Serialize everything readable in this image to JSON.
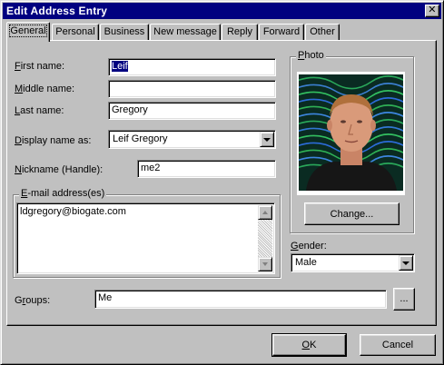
{
  "window": {
    "title": "Edit Address Entry",
    "close_glyph": "✕"
  },
  "tabs": [
    {
      "label": "General",
      "active": true
    },
    {
      "label": "Personal"
    },
    {
      "label": "Business"
    },
    {
      "label": "New message"
    },
    {
      "label": "Reply"
    },
    {
      "label": "Forward"
    },
    {
      "label": "Other"
    }
  ],
  "general": {
    "first_name": {
      "label_hotkey": "F",
      "label_rest": "irst name:",
      "value": "Leif"
    },
    "middle_name": {
      "label_hotkey": "M",
      "label_rest": "iddle name:",
      "value": ""
    },
    "last_name": {
      "label_hotkey": "L",
      "label_rest": "ast name:",
      "value": "Gregory"
    },
    "display_name": {
      "label_hotkey": "D",
      "label_rest": "isplay name as:",
      "value": "Leif Gregory"
    },
    "nickname": {
      "label_hotkey": "N",
      "label_rest": "ickname (Handle):",
      "value": "me2"
    },
    "email": {
      "legend_hotkey": "E",
      "legend_rest": "-mail address(es)",
      "value": "ldgregory@biogate.com"
    },
    "groups": {
      "label_pre": "G",
      "label_hotkey": "r",
      "label_rest": "oups:",
      "value": "Me",
      "browse_label": "..."
    }
  },
  "photo": {
    "legend_hotkey": "P",
    "legend_rest": "hoto",
    "change_label": "Change..."
  },
  "gender": {
    "label_hotkey": "G",
    "label_rest": "ender:",
    "value": "Male"
  },
  "buttons": {
    "ok_hotkey": "O",
    "ok_rest": "K",
    "cancel": "Cancel"
  },
  "colors": {
    "title_bar": "#000080",
    "face": "#c0c0c0",
    "selection": "#000080"
  }
}
